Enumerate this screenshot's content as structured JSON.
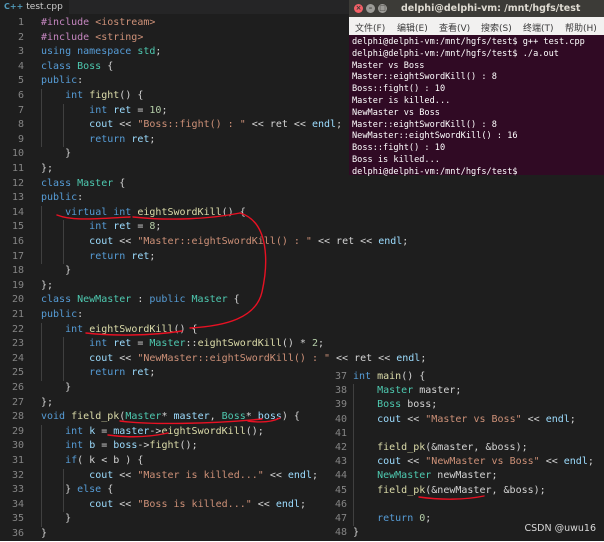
{
  "editor": {
    "tab_label": "test.cpp",
    "tab_icon": "C++",
    "lines": [
      {
        "n": "1",
        "code": [
          [
            "pp",
            "#include "
          ],
          [
            "str",
            "<iostream>"
          ]
        ]
      },
      {
        "n": "2",
        "code": [
          [
            "pp",
            "#include "
          ],
          [
            "str",
            "<string>"
          ]
        ]
      },
      {
        "n": "3",
        "code": [
          [
            "kw",
            "using namespace "
          ],
          [
            "cls",
            "std"
          ],
          [
            "op",
            ";"
          ]
        ]
      },
      {
        "n": "4",
        "code": [
          [
            "kw",
            "class "
          ],
          [
            "cls",
            "Boss"
          ],
          [
            "op",
            " {"
          ]
        ]
      },
      {
        "n": "5",
        "code": [
          [
            "kw",
            "public"
          ],
          [
            "op",
            ":"
          ]
        ]
      },
      {
        "n": "6",
        "code": [
          [
            "op",
            "    "
          ],
          [
            "kw",
            "int "
          ],
          [
            "fn",
            "fight"
          ],
          [
            "op",
            "() {"
          ]
        ]
      },
      {
        "n": "7",
        "code": [
          [
            "op",
            "        "
          ],
          [
            "kw",
            "int "
          ],
          [
            "var",
            "ret"
          ],
          [
            "op",
            " = "
          ],
          [
            "num",
            "10"
          ],
          [
            "op",
            ";"
          ]
        ]
      },
      {
        "n": "8",
        "code": [
          [
            "op",
            "        "
          ],
          [
            "var",
            "cout"
          ],
          [
            "op",
            " << "
          ],
          [
            "str",
            "\"Boss::fight() : \""
          ],
          [
            "op",
            " << ret << "
          ],
          [
            "var",
            "endl"
          ],
          [
            "op",
            ";"
          ]
        ]
      },
      {
        "n": "9",
        "code": [
          [
            "op",
            "        "
          ],
          [
            "kw",
            "return "
          ],
          [
            "var",
            "ret"
          ],
          [
            "op",
            ";"
          ]
        ]
      },
      {
        "n": "10",
        "code": [
          [
            "op",
            "    }"
          ]
        ]
      },
      {
        "n": "11",
        "code": [
          [
            "op",
            "};"
          ]
        ]
      },
      {
        "n": "12",
        "code": [
          [
            "kw",
            "class "
          ],
          [
            "cls",
            "Master"
          ],
          [
            "op",
            " {"
          ]
        ]
      },
      {
        "n": "13",
        "code": [
          [
            "kw",
            "public"
          ],
          [
            "op",
            ":"
          ]
        ]
      },
      {
        "n": "14",
        "code": [
          [
            "op",
            "    "
          ],
          [
            "kw",
            "virtual int "
          ],
          [
            "fn",
            "eightSwordKill"
          ],
          [
            "op",
            "() {"
          ]
        ]
      },
      {
        "n": "15",
        "code": [
          [
            "op",
            "        "
          ],
          [
            "kw",
            "int "
          ],
          [
            "var",
            "ret"
          ],
          [
            "op",
            " = "
          ],
          [
            "num",
            "8"
          ],
          [
            "op",
            ";"
          ]
        ]
      },
      {
        "n": "16",
        "code": [
          [
            "op",
            "        "
          ],
          [
            "var",
            "cout"
          ],
          [
            "op",
            " << "
          ],
          [
            "str",
            "\"Master::eightSwordKill() : \""
          ],
          [
            "op",
            " << ret << "
          ],
          [
            "var",
            "endl"
          ],
          [
            "op",
            ";"
          ]
        ]
      },
      {
        "n": "17",
        "code": [
          [
            "op",
            "        "
          ],
          [
            "kw",
            "return "
          ],
          [
            "var",
            "ret"
          ],
          [
            "op",
            ";"
          ]
        ]
      },
      {
        "n": "18",
        "code": [
          [
            "op",
            "    }"
          ]
        ]
      },
      {
        "n": "19",
        "code": [
          [
            "op",
            "};"
          ]
        ]
      },
      {
        "n": "20",
        "code": [
          [
            "kw",
            "class "
          ],
          [
            "cls",
            "NewMaster"
          ],
          [
            "op",
            " : "
          ],
          [
            "kw",
            "public "
          ],
          [
            "cls",
            "Master"
          ],
          [
            "op",
            " {"
          ]
        ]
      },
      {
        "n": "21",
        "code": [
          [
            "kw",
            "public"
          ],
          [
            "op",
            ":"
          ]
        ]
      },
      {
        "n": "22",
        "code": [
          [
            "op",
            "    "
          ],
          [
            "kw",
            "int "
          ],
          [
            "fn",
            "eightSwordKill"
          ],
          [
            "op",
            "() {"
          ]
        ]
      },
      {
        "n": "23",
        "code": [
          [
            "op",
            "        "
          ],
          [
            "kw",
            "int "
          ],
          [
            "var",
            "ret"
          ],
          [
            "op",
            " = "
          ],
          [
            "cls",
            "Master"
          ],
          [
            "op",
            "::"
          ],
          [
            "fn",
            "eightSwordKill"
          ],
          [
            "op",
            "() * "
          ],
          [
            "num",
            "2"
          ],
          [
            "op",
            ";"
          ]
        ]
      },
      {
        "n": "24",
        "code": [
          [
            "op",
            "        "
          ],
          [
            "var",
            "cout"
          ],
          [
            "op",
            " << "
          ],
          [
            "str",
            "\"NewMaster::eightSwordKill() : \""
          ],
          [
            "op",
            " << ret << "
          ],
          [
            "var",
            "endl"
          ],
          [
            "op",
            ";"
          ]
        ]
      },
      {
        "n": "25",
        "code": [
          [
            "op",
            "        "
          ],
          [
            "kw",
            "return "
          ],
          [
            "var",
            "ret"
          ],
          [
            "op",
            ";"
          ]
        ]
      },
      {
        "n": "26",
        "code": [
          [
            "op",
            "    }"
          ]
        ]
      },
      {
        "n": "27",
        "code": [
          [
            "op",
            "};"
          ]
        ]
      },
      {
        "n": "28",
        "code": [
          [
            "kw",
            "void "
          ],
          [
            "fn",
            "field_pk"
          ],
          [
            "op",
            "("
          ],
          [
            "cls",
            "Master"
          ],
          [
            "op",
            "* "
          ],
          [
            "var",
            "master"
          ],
          [
            "op",
            ", "
          ],
          [
            "cls",
            "Boss"
          ],
          [
            "op",
            "* "
          ],
          [
            "var",
            "boss"
          ],
          [
            "op",
            ") {"
          ]
        ]
      },
      {
        "n": "29",
        "code": [
          [
            "op",
            "    "
          ],
          [
            "kw",
            "int "
          ],
          [
            "var",
            "k"
          ],
          [
            "op",
            " = "
          ],
          [
            "var",
            "master"
          ],
          [
            "op",
            "->"
          ],
          [
            "fn",
            "eightSwordKill"
          ],
          [
            "op",
            "();"
          ]
        ]
      },
      {
        "n": "30",
        "code": [
          [
            "op",
            "    "
          ],
          [
            "kw",
            "int "
          ],
          [
            "var",
            "b"
          ],
          [
            "op",
            " = "
          ],
          [
            "var",
            "boss"
          ],
          [
            "op",
            "->"
          ],
          [
            "fn",
            "fight"
          ],
          [
            "op",
            "();"
          ]
        ]
      },
      {
        "n": "31",
        "code": [
          [
            "op",
            "    "
          ],
          [
            "kw",
            "if"
          ],
          [
            "op",
            "( k < b ) {"
          ]
        ]
      },
      {
        "n": "32",
        "code": [
          [
            "op",
            "        "
          ],
          [
            "var",
            "cout"
          ],
          [
            "op",
            " << "
          ],
          [
            "str",
            "\"Master is killed...\""
          ],
          [
            "op",
            " << "
          ],
          [
            "var",
            "endl"
          ],
          [
            "op",
            ";"
          ]
        ]
      },
      {
        "n": "33",
        "code": [
          [
            "op",
            "    } "
          ],
          [
            "kw",
            "else"
          ],
          [
            "op",
            " {"
          ]
        ]
      },
      {
        "n": "34",
        "code": [
          [
            "op",
            "        "
          ],
          [
            "var",
            "cout"
          ],
          [
            "op",
            " << "
          ],
          [
            "str",
            "\"Boss is killed...\""
          ],
          [
            "op",
            " << "
          ],
          [
            "var",
            "endl"
          ],
          [
            "op",
            ";"
          ]
        ]
      },
      {
        "n": "35",
        "code": [
          [
            "op",
            "    }"
          ]
        ]
      },
      {
        "n": "36",
        "code": [
          [
            "op",
            "}"
          ]
        ]
      }
    ]
  },
  "terminal": {
    "title": "delphi@delphi-vm: /mnt/hgfs/test",
    "menu": [
      "文件(F)",
      "编辑(E)",
      "查看(V)",
      "搜索(S)",
      "终端(T)",
      "帮助(H)"
    ],
    "output": [
      "delphi@delphi-vm:/mnt/hgfs/test$ g++ test.cpp",
      "delphi@delphi-vm:/mnt/hgfs/test$ ./a.out",
      "Master vs Boss",
      "Master::eightSwordKill() : 8",
      "Boss::fight() : 10",
      "Master is killed...",
      "NewMaster vs Boss",
      "Master::eightSwordKill() : 8",
      "NewMaster::eightSwordKill() : 16",
      "Boss::fight() : 10",
      "Boss is killed...",
      "delphi@delphi-vm:/mnt/hgfs/test$"
    ]
  },
  "main_panel": {
    "lines": [
      {
        "n": "37",
        "code": [
          [
            "kw",
            "int "
          ],
          [
            "fn",
            "main"
          ],
          [
            "op",
            "() {"
          ]
        ]
      },
      {
        "n": "38",
        "code": [
          [
            "op",
            "    "
          ],
          [
            "cls",
            "Master"
          ],
          [
            "op",
            " master;"
          ]
        ]
      },
      {
        "n": "39",
        "code": [
          [
            "op",
            "    "
          ],
          [
            "cls",
            "Boss"
          ],
          [
            "op",
            " boss;"
          ]
        ]
      },
      {
        "n": "40",
        "code": [
          [
            "op",
            "    "
          ],
          [
            "var",
            "cout"
          ],
          [
            "op",
            " << "
          ],
          [
            "str",
            "\"Master vs Boss\""
          ],
          [
            "op",
            " << "
          ],
          [
            "var",
            "endl"
          ],
          [
            "op",
            ";"
          ]
        ]
      },
      {
        "n": "41",
        "code": [
          [
            "op",
            ""
          ]
        ]
      },
      {
        "n": "42",
        "code": [
          [
            "op",
            "    "
          ],
          [
            "fn",
            "field_pk"
          ],
          [
            "op",
            "(&master, &boss);"
          ]
        ]
      },
      {
        "n": "43",
        "code": [
          [
            "op",
            "    "
          ],
          [
            "var",
            "cout"
          ],
          [
            "op",
            " << "
          ],
          [
            "str",
            "\"NewMaster vs Boss\""
          ],
          [
            "op",
            " << "
          ],
          [
            "var",
            "endl"
          ],
          [
            "op",
            ";"
          ]
        ]
      },
      {
        "n": "44",
        "code": [
          [
            "op",
            "    "
          ],
          [
            "cls",
            "NewMaster"
          ],
          [
            "op",
            " newMaster;"
          ]
        ]
      },
      {
        "n": "45",
        "code": [
          [
            "op",
            "    "
          ],
          [
            "fn",
            "field_pk"
          ],
          [
            "op",
            "(&newMaster, &boss);"
          ]
        ]
      },
      {
        "n": "46",
        "code": [
          [
            "op",
            ""
          ]
        ]
      },
      {
        "n": "47",
        "code": [
          [
            "op",
            "    "
          ],
          [
            "kw",
            "return "
          ],
          [
            "num",
            "0"
          ],
          [
            "op",
            ";"
          ]
        ]
      },
      {
        "n": "48",
        "code": [
          [
            "op",
            "}"
          ]
        ]
      }
    ]
  },
  "watermark": "CSDN @uwu16",
  "colors": {
    "keyword": "#569cd6",
    "class": "#4ec9b0",
    "function": "#dcdcaa",
    "string": "#ce9178",
    "number": "#b5cea8",
    "variable": "#9cdcfe",
    "annotation": "#e81123",
    "terminal_bg": "#300a24"
  }
}
